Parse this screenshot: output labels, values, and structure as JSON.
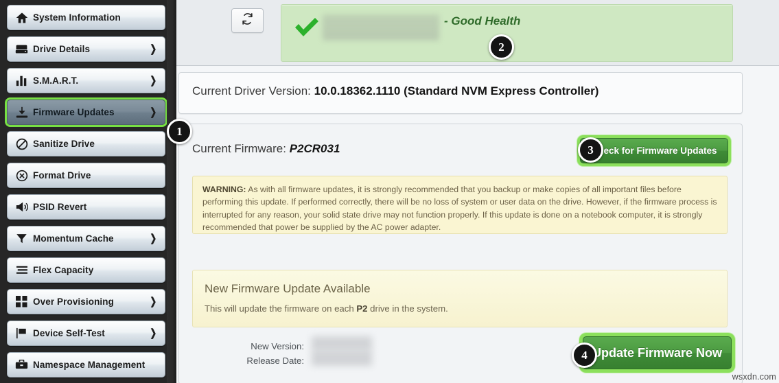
{
  "sidebar": {
    "items": [
      {
        "label": "System Information",
        "icon": "home-icon",
        "chevron": false,
        "selected": false
      },
      {
        "label": "Drive Details",
        "icon": "hard-drive-icon",
        "chevron": true,
        "selected": false
      },
      {
        "label": "S.M.A.R.T.",
        "icon": "bar-chart-icon",
        "chevron": true,
        "selected": false
      },
      {
        "label": "Firmware Updates",
        "icon": "download-icon",
        "chevron": true,
        "selected": true
      },
      {
        "label": "Sanitize Drive",
        "icon": "prohibition-icon",
        "chevron": false,
        "selected": false
      },
      {
        "label": "Format Drive",
        "icon": "circle-x-icon",
        "chevron": false,
        "selected": false
      },
      {
        "label": "PSID Revert",
        "icon": "megaphone-icon",
        "chevron": false,
        "selected": false
      },
      {
        "label": "Momentum Cache",
        "icon": "funnel-icon",
        "chevron": true,
        "selected": false
      },
      {
        "label": "Flex Capacity",
        "icon": "list-lines-icon",
        "chevron": false,
        "selected": false
      },
      {
        "label": "Over Provisioning",
        "icon": "grid-squares-icon",
        "chevron": true,
        "selected": false
      },
      {
        "label": "Device Self-Test",
        "icon": "flag-icon",
        "chevron": true,
        "selected": false
      },
      {
        "label": "Namespace Management",
        "icon": "briefcase-icon",
        "chevron": false,
        "selected": false
      }
    ]
  },
  "topbar": {
    "refresh_icon": "refresh-icon",
    "health_status_icon": "green-check-icon",
    "drive_name_redacted": "",
    "health_text": "- Good Health"
  },
  "driver": {
    "label": "Current Driver Version: ",
    "value": "10.0.18362.1110 (Standard NVM Express Controller)"
  },
  "firmware": {
    "current_label": "Current Firmware: ",
    "current_value": "P2CR031",
    "check_button_label": "Check for Firmware Updates",
    "warning_prefix": "WARNING:",
    "warning_text": " As with all firmware updates, it is strongly recommended that you backup or make copies of all important files before performing this update. If performed correctly, there will be no loss of system or user data on the drive. However, if the firmware process is interrupted for any reason, your solid state drive may not function properly. If this update is done on a notebook computer, it is strongly recommended that power be supplied by the AC power adapter.",
    "update_available_title": "New Firmware Update Available",
    "update_available_sub_pre": "This will update the firmware on each ",
    "update_available_sub_bold": "P2",
    "update_available_sub_post": " drive in the system.",
    "new_version_label": "New Version:",
    "new_version_value": "",
    "release_date_label": "Release Date:",
    "release_date_value": "",
    "update_button_label": "Update Firmware Now"
  },
  "callouts": {
    "one": "1",
    "two": "2",
    "three": "3",
    "four": "4"
  },
  "watermark": "wsxdn.com",
  "colors": {
    "accent_green": "#4b9a41",
    "highlight_green": "#8ce05c",
    "health_bg": "#cfe8c2",
    "warning_bg": "#faf5d2",
    "sidebar_bg": "#262626"
  }
}
